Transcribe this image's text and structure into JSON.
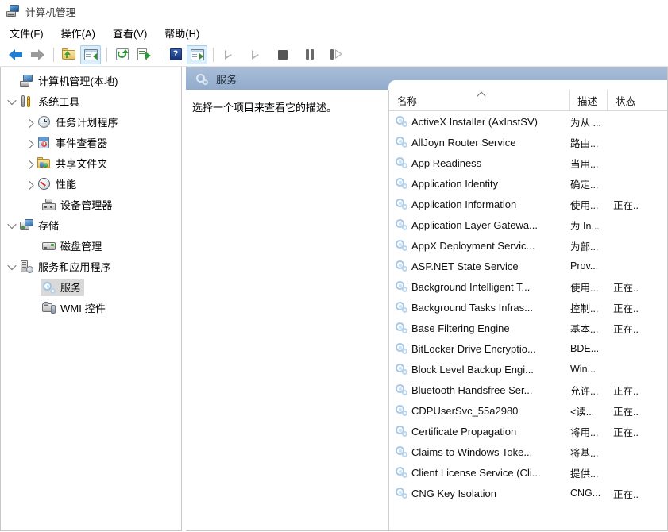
{
  "window": {
    "title": "计算机管理",
    "icon": "computer-management-icon"
  },
  "menu": {
    "items": [
      {
        "label": "文件(F)",
        "name": "menu-file"
      },
      {
        "label": "操作(A)",
        "name": "menu-action"
      },
      {
        "label": "查看(V)",
        "name": "menu-view"
      },
      {
        "label": "帮助(H)",
        "name": "menu-help"
      }
    ]
  },
  "toolbar": {
    "buttons": [
      {
        "icon": "back-arrow-icon",
        "framed": false
      },
      {
        "icon": "forward-arrow-icon",
        "framed": false
      },
      {
        "icon": "up-folder-icon",
        "framed": false
      },
      {
        "icon": "show-hide-console-tree-icon",
        "framed": true
      },
      {
        "icon": "refresh-icon",
        "framed": false
      },
      {
        "icon": "export-list-icon",
        "framed": false
      },
      {
        "icon": "help-icon",
        "framed": false
      },
      {
        "icon": "show-action-pane-icon",
        "framed": true
      },
      {
        "icon": "start-service-icon",
        "framed": false
      },
      {
        "icon": "resume-service-icon",
        "framed": false
      },
      {
        "icon": "stop-service-icon",
        "framed": false
      },
      {
        "icon": "pause-service-icon",
        "framed": false
      },
      {
        "icon": "restart-service-icon",
        "framed": false
      }
    ]
  },
  "tree": {
    "nodes": [
      {
        "label": "计算机管理(本地)",
        "icon": "computer-icon",
        "level": 0,
        "twist": "none",
        "selected": false,
        "name": "tree-item-computer-management-local"
      },
      {
        "label": "系统工具",
        "icon": "system-tools-icon",
        "level": 1,
        "twist": "expanded",
        "selected": false,
        "name": "tree-item-system-tools"
      },
      {
        "label": "任务计划程序",
        "icon": "task-scheduler-icon",
        "level": 2,
        "twist": "collapsed",
        "selected": false,
        "name": "tree-item-task-scheduler"
      },
      {
        "label": "事件查看器",
        "icon": "event-viewer-icon",
        "level": 2,
        "twist": "collapsed",
        "selected": false,
        "name": "tree-item-event-viewer"
      },
      {
        "label": "共享文件夹",
        "icon": "shared-folders-icon",
        "level": 2,
        "twist": "collapsed",
        "selected": false,
        "name": "tree-item-shared-folders"
      },
      {
        "label": "性能",
        "icon": "performance-icon",
        "level": 2,
        "twist": "collapsed",
        "selected": false,
        "name": "tree-item-performance"
      },
      {
        "label": "设备管理器",
        "icon": "device-manager-icon",
        "level": 2,
        "twist": "none",
        "selected": false,
        "name": "tree-item-device-manager"
      },
      {
        "label": "存储",
        "icon": "storage-icon",
        "level": 1,
        "twist": "expanded",
        "selected": false,
        "name": "tree-item-storage"
      },
      {
        "label": "磁盘管理",
        "icon": "disk-management-icon",
        "level": 2,
        "twist": "none",
        "selected": false,
        "name": "tree-item-disk-management"
      },
      {
        "label": "服务和应用程序",
        "icon": "services-apps-icon",
        "level": 1,
        "twist": "expanded",
        "selected": false,
        "name": "tree-item-services-and-applications"
      },
      {
        "label": "服务",
        "icon": "service-gear-icon",
        "level": 2,
        "twist": "none",
        "selected": true,
        "name": "tree-item-services"
      },
      {
        "label": "WMI 控件",
        "icon": "wmi-control-icon",
        "level": 2,
        "twist": "none",
        "selected": false,
        "name": "tree-item-wmi-control"
      }
    ]
  },
  "pane": {
    "header_title": "服务",
    "header_icon": "service-gear-icon",
    "description_prompt": "选择一个项目来查看它的描述。"
  },
  "list": {
    "columns": [
      {
        "label": "名称",
        "name": "column-header-name",
        "sort": "ascending"
      },
      {
        "label": "描述",
        "name": "column-header-description",
        "sort": "none"
      },
      {
        "label": "状态",
        "name": "column-header-status",
        "sort": "none"
      }
    ],
    "rows": [
      {
        "name": "ActiveX Installer (AxInstSV)",
        "description": "为从 ...",
        "status": ""
      },
      {
        "name": "AllJoyn Router Service",
        "description": "路由...",
        "status": ""
      },
      {
        "name": "App Readiness",
        "description": "当用...",
        "status": ""
      },
      {
        "name": "Application Identity",
        "description": "确定...",
        "status": ""
      },
      {
        "name": "Application Information",
        "description": "使用...",
        "status": "正在.."
      },
      {
        "name": "Application Layer Gatewa...",
        "description": "为 In...",
        "status": ""
      },
      {
        "name": "AppX Deployment Servic...",
        "description": "为部...",
        "status": ""
      },
      {
        "name": "ASP.NET State Service",
        "description": "Prov...",
        "status": ""
      },
      {
        "name": "Background Intelligent T...",
        "description": "使用...",
        "status": "正在.."
      },
      {
        "name": "Background Tasks Infras...",
        "description": "控制...",
        "status": "正在.."
      },
      {
        "name": "Base Filtering Engine",
        "description": "基本...",
        "status": "正在.."
      },
      {
        "name": "BitLocker Drive Encryptio...",
        "description": "BDE...",
        "status": ""
      },
      {
        "name": "Block Level Backup Engi...",
        "description": "Win...",
        "status": ""
      },
      {
        "name": "Bluetooth Handsfree Ser...",
        "description": "允许...",
        "status": "正在.."
      },
      {
        "name": "CDPUserSvc_55a2980",
        "description": "<读...",
        "status": "正在.."
      },
      {
        "name": "Certificate Propagation",
        "description": "将用...",
        "status": "正在.."
      },
      {
        "name": "Claims to Windows Toke...",
        "description": "将基...",
        "status": ""
      },
      {
        "name": "Client License Service (Cli...",
        "description": "提供...",
        "status": ""
      },
      {
        "name": "CNG Key Isolation",
        "description": "CNG...",
        "status": "正在.."
      }
    ]
  },
  "colors": {
    "pane_header_top": "#a8bdd8",
    "pane_header_bottom": "#93abcb",
    "selection_gray": "#d9d9d9",
    "toolbar_frame": "#a8cce9",
    "toolbar_frame_fill": "#ddeefb",
    "service_icon_blue": "#a9c9e6"
  }
}
